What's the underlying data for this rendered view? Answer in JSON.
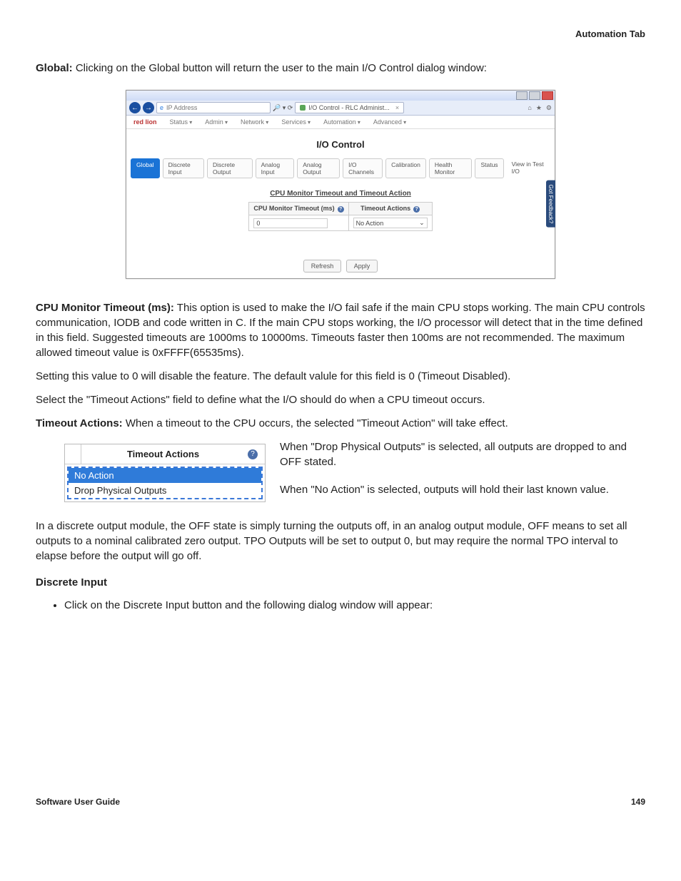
{
  "page": {
    "header_right": "Automation Tab",
    "footer_left": "Software User Guide",
    "footer_right": "149"
  },
  "intro": {
    "global_label": "Global:",
    "global_text": " Clicking on the Global button will return the user to the main I/O Control dialog window:"
  },
  "shot1": {
    "address_placeholder": "IP Address",
    "search_icons": "🔎 ▾ ⟳",
    "tab_label": "I/O Control - RLC Administ...",
    "top_icons": [
      "⌂",
      "★",
      "⚙"
    ],
    "brand": "red lion",
    "menus": [
      "Status",
      "Admin",
      "Network",
      "Services",
      "Automation",
      "Advanced"
    ],
    "title": "I/O Control",
    "tabs": [
      "Global",
      "Discrete Input",
      "Discrete Output",
      "Analog Input",
      "Analog Output",
      "I/O Channels",
      "Calibration",
      "Health Monitor",
      "Status",
      "View in Test I/O"
    ],
    "active_tab_index": 0,
    "section": "CPU Monitor Timeout and Timeout Action",
    "col1": "CPU Monitor Timeout (ms)",
    "col2": "Timeout Actions",
    "val1": "0",
    "val2": "No Action",
    "feedback": "Got Feedback?",
    "refresh": "Refresh",
    "apply": "Apply"
  },
  "para_cpu": {
    "label": "CPU Monitor Timeout (ms):",
    "text": " This option is used to make the I/O fail safe if the main CPU stops working. The main CPU controls communication, IODB and code written in C. If the main CPU stops working, the I/O processor will detect that in the time defined in this field. Suggested timeouts are 1000ms to 10000ms. Timeouts faster then 100ms are not recommended. The maximum allowed timeout value is 0xFFFF(65535ms)."
  },
  "para_zero": "Setting this value to 0 will disable the feature. The default valule for this field is 0 (Timeout Disabled).",
  "para_select": "Select the \"Timeout Actions\" field to define what the I/O should do when a CPU timeout occurs.",
  "para_timeout": {
    "label": "Timeout Actions:",
    "text": " When a timeout to the CPU occurs, the selected \"Timeout Action\" will take effect."
  },
  "shot2": {
    "header": "Timeout Actions",
    "options": [
      "No Action",
      "Drop Physical Outputs"
    ],
    "selected_index": 0
  },
  "float_p1": "When \"Drop Physical Outputs\" is selected, all outputs are dropped to and OFF stated.",
  "float_p2": "When \"No Action\" is selected, outputs will hold their last known value.",
  "para_discrete_module": "In a discrete output module, the OFF state is simply turning the outputs off, in an analog output module, OFF means to set all outputs to a nominal calibrated zero output. TPO Outputs will be set to output 0, but may require the normal TPO interval to elapse before the output will go off.",
  "heading_di": "Discrete Input",
  "bullet_di": "Click on the Discrete Input button and the following dialog window will appear:"
}
